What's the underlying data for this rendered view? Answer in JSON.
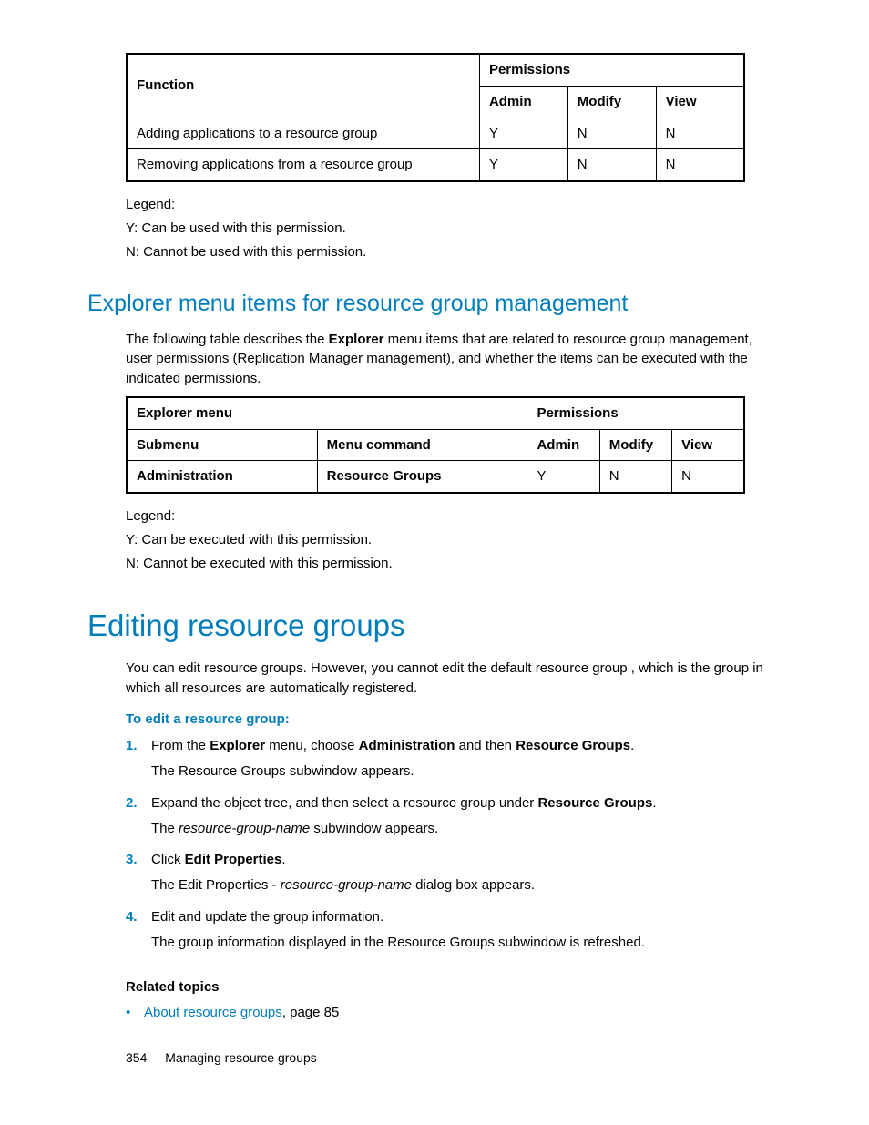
{
  "table1": {
    "head": {
      "function": "Function",
      "permissions": "Permissions",
      "admin": "Admin",
      "modify": "Modify",
      "view": "View"
    },
    "rows": [
      {
        "fn": "Adding applications to a resource group",
        "a": "Y",
        "m": "N",
        "v": "N"
      },
      {
        "fn": "Removing applications from a resource group",
        "a": "Y",
        "m": "N",
        "v": "N"
      }
    ],
    "legend_label": "Legend:",
    "legend_y": "Y: Can be used with this permission.",
    "legend_n": "N: Cannot be used with this permission."
  },
  "section1": {
    "heading": "Explorer menu items for resource group management",
    "para_a": "The following table describes the ",
    "para_b": "Explorer",
    "para_c": " menu items that are related to resource group management, user permissions (Replication Manager management), and whether the items can be executed with the indicated permissions."
  },
  "table2": {
    "head": {
      "explorer": "Explorer menu",
      "permissions": "Permissions",
      "submenu": "Submenu",
      "menucmd": "Menu command",
      "admin": "Admin",
      "modify": "Modify",
      "view": "View"
    },
    "row": {
      "sub": "Administration",
      "cmd": "Resource Groups",
      "a": "Y",
      "m": "N",
      "v": "N"
    },
    "legend_label": "Legend:",
    "legend_y": "Y: Can be executed with this permission.",
    "legend_n": "N: Cannot be executed with this permission."
  },
  "section2": {
    "heading": "Editing resource groups",
    "intro": "You can edit resource groups. However, you cannot edit the default resource group                               , which is the group in which all resources are automatically registered.",
    "proc_head": "To edit a resource group:",
    "steps": [
      {
        "num": "1.",
        "parts": [
          "From the ",
          "Explorer",
          " menu, choose ",
          "Administration",
          " and then ",
          "Resource Groups",
          "."
        ],
        "sub": "The Resource Groups subwindow appears."
      },
      {
        "num": "2.",
        "parts": [
          "Expand the object tree, and then select a resource group under ",
          "Resource Groups",
          "."
        ],
        "sub_pre": "The ",
        "sub_it": "resource-group-name",
        "sub_post": " subwindow appears."
      },
      {
        "num": "3.",
        "parts": [
          "Click ",
          "Edit Properties",
          "."
        ],
        "sub_pre": "The Edit Properties - ",
        "sub_it": "resource-group-name",
        "sub_post": " dialog box appears."
      },
      {
        "num": "4.",
        "plain": "Edit and update the group information.",
        "sub": "The group information displayed in the Resource Groups subwindow is refreshed."
      }
    ],
    "related_head": "Related topics",
    "related_link": "About resource groups",
    "related_suffix": ", page 85"
  },
  "footer": {
    "page": "354",
    "title": "Managing resource groups"
  }
}
